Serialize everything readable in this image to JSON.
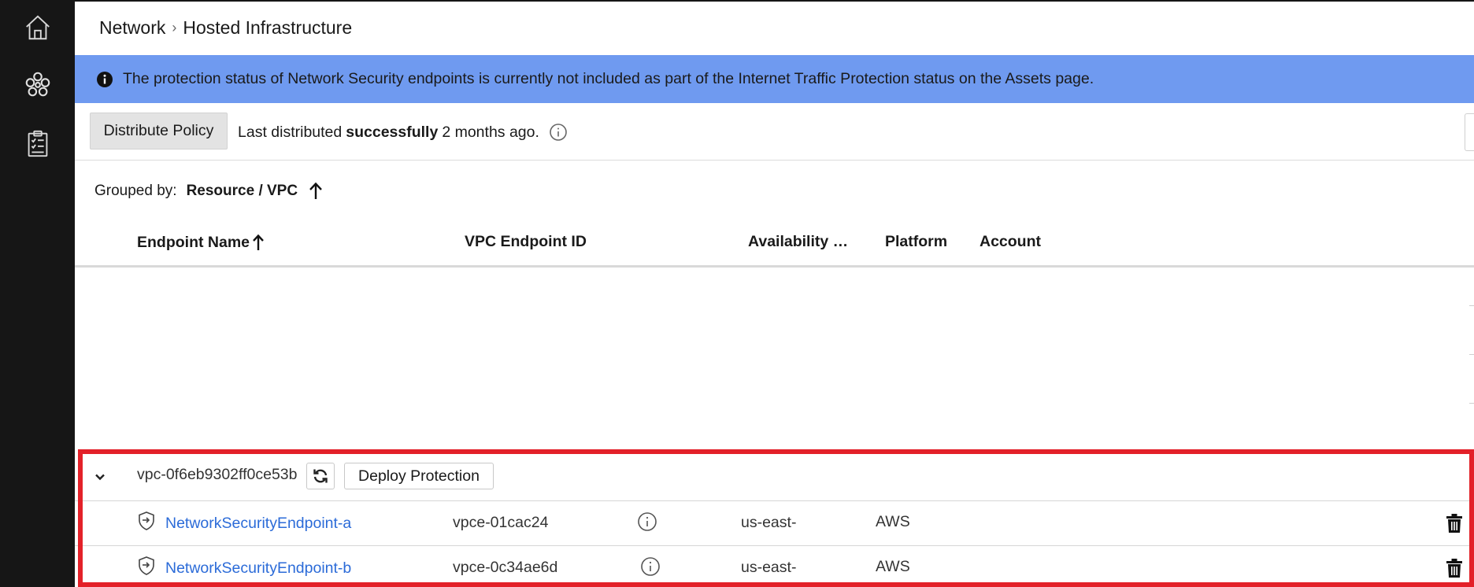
{
  "breadcrumb": {
    "parent": "Network",
    "separator": "›",
    "current": "Hosted Infrastructure"
  },
  "banner": {
    "text": "The protection status of Network Security endpoints is currently not included as part of the Internet Traffic Protection status on the Assets page.",
    "background": "#6f9af0",
    "icon": "info-icon"
  },
  "toolbar": {
    "distribute_label": "Distribute Policy",
    "status_prefix": "Last distributed",
    "status_bold": "successfully",
    "status_suffix": "2 months ago."
  },
  "grouping": {
    "label": "Grouped by:",
    "value": "Resource / VPC",
    "direction": "ascending"
  },
  "table": {
    "columns": [
      "Endpoint Name",
      "VPC Endpoint ID",
      "Availability …",
      "Platform",
      "Account"
    ],
    "sorted_column": "Endpoint Name",
    "groups": [
      {
        "vpc_id": "vpc-0f6eb9302ff0ce53b",
        "expanded": true,
        "deploy_label": "Deploy Protection",
        "rows": [
          {
            "name": "NetworkSecurityEndpoint-a",
            "vpce": "vpce-01cac24",
            "az": "us-east-",
            "platform": "AWS",
            "account": ""
          },
          {
            "name": "NetworkSecurityEndpoint-b",
            "vpce": "vpce-0c34ae6d",
            "az": "us-east-",
            "platform": "AWS",
            "account": ""
          }
        ]
      }
    ]
  },
  "colors": {
    "sidebar": "#161616",
    "link": "#2b6bd8",
    "highlight": "#e32129"
  },
  "icons": {
    "rail": [
      "home-icon",
      "network-icon",
      "clipboard-checklist-icon"
    ]
  }
}
